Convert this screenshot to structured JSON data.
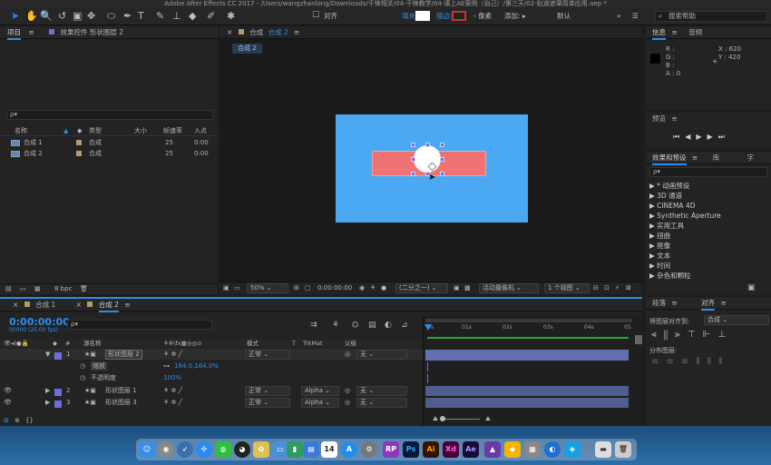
{
  "title_bar": {
    "text": "Adobe After Effects CC 2017 - /Users/wangzhanlong/Downloads/千锋相关/04-千锋教学/04-课上AE案例（自己）/第三天/02-轨道遮罩简单应用.aep *"
  },
  "toolbar": {
    "snap_label": "对齐",
    "fill_label": "填充:",
    "stroke_label": "描边:",
    "stroke_px": "- 像素",
    "add_label": "添加:",
    "workspace_label": "默认",
    "search_help_placeholder": "搜索帮助"
  },
  "project_panel": {
    "tab_label": "项目",
    "effect_controls_label": "效果控件 形状图层 2",
    "search_icon_label": "ρ▾",
    "columns": [
      "名称",
      "类型",
      "大小",
      "帧速率",
      "入点"
    ],
    "items": [
      {
        "name": "合成 1",
        "type": "合成",
        "fps": "25",
        "in": "0:00"
      },
      {
        "name": "合成 2",
        "type": "合成",
        "fps": "25",
        "in": "0:00"
      }
    ],
    "bpc": "8 bpc"
  },
  "composition_panel": {
    "tab_label": "合成",
    "tab_name": "合成 2",
    "sub_tab": "合成 2",
    "zoom": "50%",
    "timecode": "0:00:00:00",
    "resolution": "(二分之一)",
    "camera": "活动摄像机",
    "views": "1 个视图"
  },
  "info_panel": {
    "tab_label": "信息",
    "audio_tab_label": "音频",
    "r": "R :",
    "g": "G :",
    "b": "B :",
    "a": "A : 0",
    "x": "X : 620",
    "y": "Y : 420"
  },
  "preview_panel": {
    "tab_label": "预览"
  },
  "effects_panel": {
    "tab_label": "效果和预设",
    "library_tab_label": "库",
    "chars_tab_label": "字",
    "search_label": "ρ▾",
    "items": [
      "▶ * 动画预设",
      "▶ 3D 通道",
      "▶ CINEMA 4D",
      "▶ Synthetic Aperture",
      "▶ 实用工具",
      "▶ 扭曲",
      "▶ 抠像",
      "▶ 文本",
      "▶ 时间",
      "▶ 杂色和颗粒"
    ]
  },
  "align_panel": {
    "para_tab_label": "段落",
    "align_tab_label": "对齐",
    "align_to_label": "将图层对齐到:",
    "align_to_value": "合成",
    "distribute_label": "分布图层:"
  },
  "timeline": {
    "tab1": "合成 1",
    "tab2": "合成 2",
    "timecode": "0:00:00:00",
    "fps_info": "00000 (25.00 fps)",
    "col_num": "#",
    "col_source": "源名称",
    "col_mode": "模式",
    "col_t": "T",
    "col_trkmat": "TrkMat",
    "col_parent": "父级",
    "ruler": [
      "0s",
      "01s",
      "02s",
      "03s",
      "04s",
      "05"
    ],
    "layers": [
      {
        "num": "1",
        "name": "形状图层 2",
        "mode": "正常",
        "trkmat": "",
        "parent": "无"
      },
      {
        "num": "2",
        "name": "形状图层 1",
        "mode": "正常",
        "trkmat": "Alpha",
        "parent": "无"
      },
      {
        "num": "3",
        "name": "形状图层 3",
        "mode": "正常",
        "trkmat": "Alpha",
        "parent": "无"
      }
    ],
    "props": [
      {
        "label": "缩放",
        "value": "164.0,164.0%"
      },
      {
        "label": "不透明度",
        "value": "100%"
      }
    ]
  },
  "dock": {
    "icons": [
      "finder-icon",
      "launchpad-icon",
      "rocket-icon",
      "safari-icon",
      "wechat-icon",
      "qq-icon",
      "photos-icon",
      "folder-icon",
      "chart-icon",
      "keynote-icon",
      "calendar-icon",
      "appstore-icon",
      "settings-icon",
      "rp-icon",
      "photoshop-icon",
      "illustrator-icon",
      "xd-icon",
      "aftereffects-icon",
      "animate-icon",
      "sketch-icon",
      "prefs-icon",
      "browser-icon",
      "app-icon",
      "finder2-icon",
      "trash-icon"
    ],
    "labels": {
      "rp": "RP",
      "ps": "Ps",
      "ai": "Ai",
      "xd": "Xd",
      "ae": "Ae",
      "cal": "14"
    }
  },
  "colors": {
    "accent": "#2d8ceb",
    "canvas": "#4aa9f2",
    "bar": "#ef7373",
    "layer_label": "#6d6de0",
    "clip": "#5a6aa8"
  }
}
